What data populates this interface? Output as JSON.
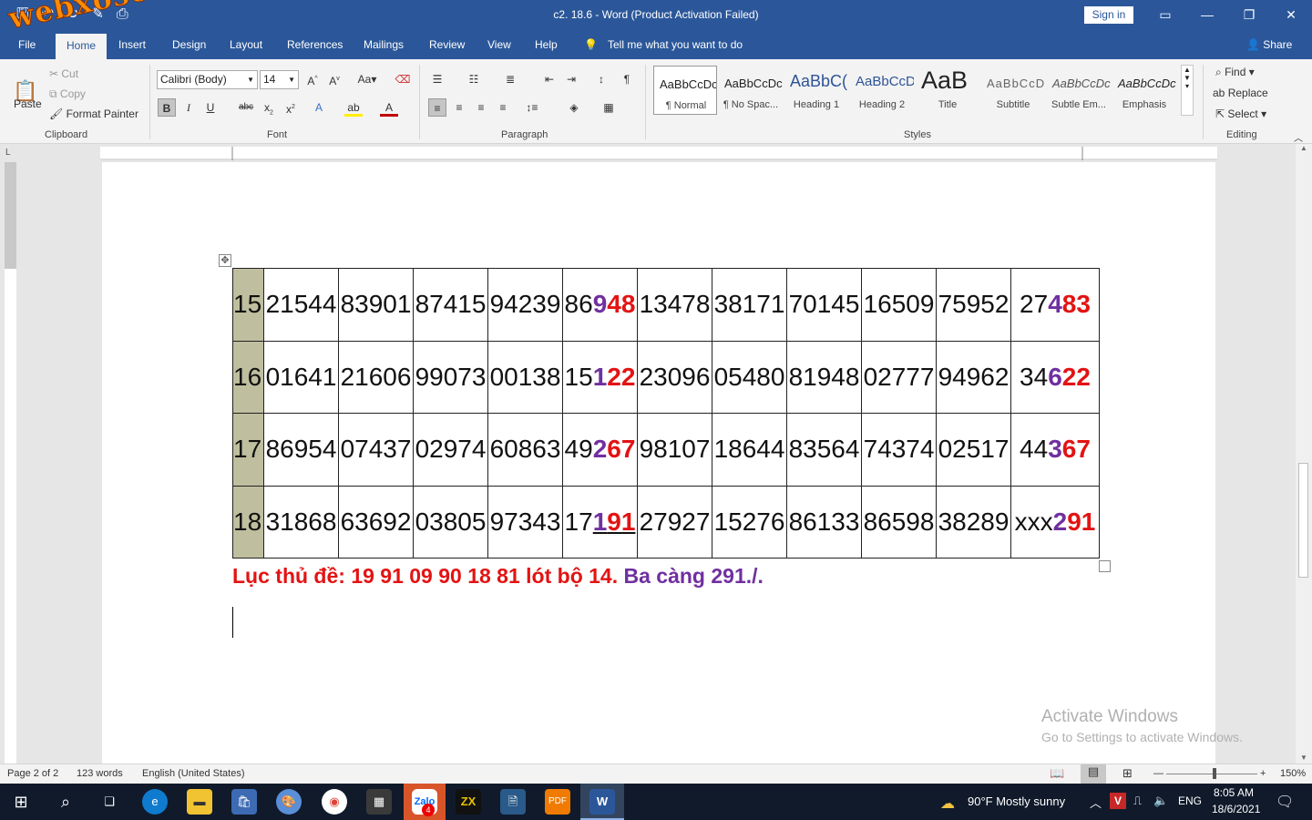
{
  "window": {
    "title": "c2. 18.6  -  Word (Product Activation Failed)",
    "sign_in": "Sign in"
  },
  "watermark": "webxoso.net",
  "tabs": [
    "File",
    "Home",
    "Insert",
    "Design",
    "Layout",
    "References",
    "Mailings",
    "Review",
    "View",
    "Help"
  ],
  "tell_me": "Tell me what you want to do",
  "share": "Share",
  "clipboard": {
    "paste": "Paste",
    "cut": "Cut",
    "copy": "Copy",
    "format_painter": "Format Painter",
    "label": "Clipboard"
  },
  "font": {
    "name": "Calibri (Body)",
    "size": "14",
    "label": "Font"
  },
  "paragraph": {
    "label": "Paragraph"
  },
  "styles": {
    "label": "Styles",
    "items": [
      {
        "preview": "AaBbCcDc",
        "name": "¶ Normal"
      },
      {
        "preview": "AaBbCcDc",
        "name": "¶ No Spac..."
      },
      {
        "preview": "AaBbC(",
        "name": "Heading 1"
      },
      {
        "preview": "AaBbCcD",
        "name": "Heading 2"
      },
      {
        "preview": "AaB",
        "name": "Title"
      },
      {
        "preview": "AaBbCcD",
        "name": "Subtitle"
      },
      {
        "preview": "AaBbCcDc",
        "name": "Subtle Em..."
      },
      {
        "preview": "AaBbCcDc",
        "name": "Emphasis"
      }
    ]
  },
  "editing": {
    "find": "Find",
    "replace": "Replace",
    "select": "Select",
    "label": "Editing"
  },
  "table": [
    {
      "day": "15",
      "cells": [
        "21544",
        "83901",
        "87415",
        "94239"
      ],
      "hl": {
        "pre": "86",
        "mid": "9",
        "end": "48"
      },
      "rest": [
        "13478",
        "38171",
        "70145",
        "16509",
        "75952"
      ],
      "last": {
        "pre": "27",
        "mid": "4",
        "end": "83"
      }
    },
    {
      "day": "16",
      "cells": [
        "01641",
        "21606",
        "99073",
        "00138"
      ],
      "hl": {
        "pre": "15",
        "mid": "1",
        "end": "22"
      },
      "rest": [
        "23096",
        "05480",
        "81948",
        "02777",
        "94962"
      ],
      "last": {
        "pre": "34",
        "mid": "6",
        "end": "22"
      }
    },
    {
      "day": "17",
      "cells": [
        "86954",
        "07437",
        "02974",
        "60863"
      ],
      "hl": {
        "pre": "49",
        "mid": "2",
        "end": "67"
      },
      "rest": [
        "98107",
        "18644",
        "83564",
        "74374",
        "02517"
      ],
      "last": {
        "pre": "44",
        "mid": "3",
        "end": "67"
      }
    },
    {
      "day": "18",
      "cells": [
        "31868",
        "63692",
        "03805",
        "97343"
      ],
      "hl": {
        "pre": "17",
        "mid": "1",
        "end": "91"
      },
      "rest": [
        "27927",
        "15276",
        "86133",
        "86598",
        "38289"
      ],
      "last": {
        "pre": "xxx",
        "mid": "2",
        "end": "91"
      }
    }
  ],
  "summary": {
    "red": "Lục thủ đề: 19 91 09 90 18 81 lót bộ 14.",
    "purple": "Ba càng 291./."
  },
  "activate": {
    "title": "Activate Windows",
    "subtitle": "Go to Settings to activate Windows."
  },
  "status": {
    "page": "Page 2 of 2",
    "words": "123 words",
    "language": "English (United States)",
    "zoom": "150%"
  },
  "taskbar": {
    "weather": "90°F  Mostly sunny",
    "lang": "ENG",
    "time": "8:05 AM",
    "date": "18/6/2021",
    "badge": "4"
  }
}
